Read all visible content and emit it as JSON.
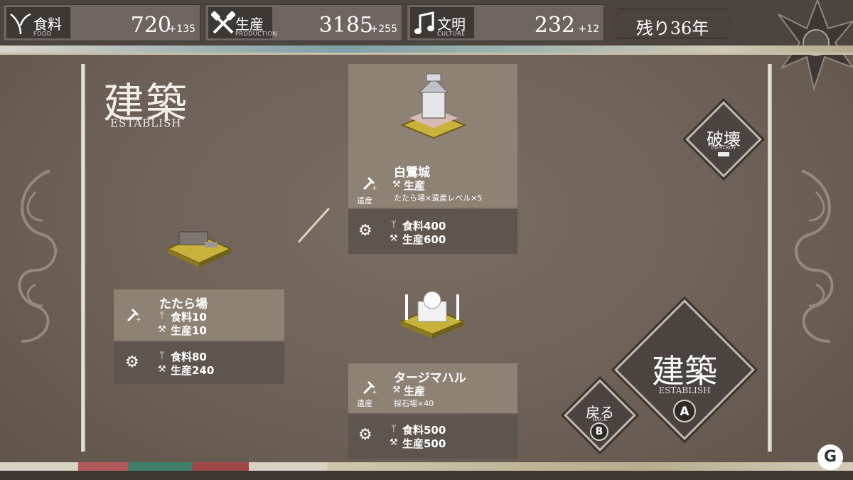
{
  "resources": [
    {
      "jp": "食料",
      "en": "FOOD",
      "value": "720",
      "plus": "+135",
      "icon": "sprout-icon"
    },
    {
      "jp": "生産",
      "en": "PRODUCTION",
      "value": "3185",
      "plus": "+255",
      "icon": "hammers-icon"
    },
    {
      "jp": "文明",
      "en": "CULTURE",
      "value": "232",
      "plus": "+12",
      "icon": "music-note-icon"
    }
  ],
  "years_left": "残り36年",
  "title": {
    "jp": "建築",
    "en": "ESTABLISH"
  },
  "tatara": {
    "name": "たたら場",
    "build_food": "食料10",
    "build_prod": "生産10",
    "upkeep_food": "食料80",
    "upkeep_prod": "生産240"
  },
  "shirasagi": {
    "name": "白鷺城",
    "heritage": "遺産",
    "effect": "生産",
    "detail": "たたら場×遺産レベル×5",
    "food": "食料400",
    "prod": "生産600"
  },
  "taj": {
    "name": "タージマハル",
    "heritage": "遺産",
    "effect": "生産",
    "detail": "採石場×40",
    "food": "食料500",
    "prod": "生産500"
  },
  "buttons": {
    "destroy_jp": "破壊",
    "destroy_en": "DESTROY",
    "back_jp": "戻る",
    "back_en": "BACK",
    "back_key": "B",
    "establish_jp": "建築",
    "establish_en": "ESTABLISH",
    "establish_key": "A"
  },
  "colors": {
    "panel_light": "#8e8275",
    "panel_dark": "#5e554e",
    "background": "#6e6257"
  }
}
